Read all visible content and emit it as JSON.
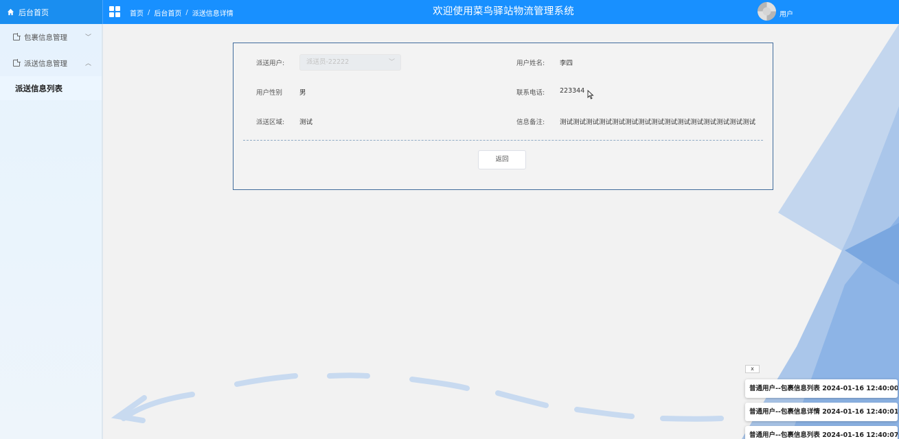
{
  "header": {
    "home_label": "后台首页",
    "breadcrumb": [
      "首页",
      "后台首页",
      "派送信息详情"
    ],
    "breadcrumb_sep": "/",
    "title": "欢迎使用菜鸟驿站物流管理系统",
    "user_label": "用户",
    "bg_color": "#1890ff"
  },
  "sidebar": {
    "groups": [
      {
        "label": "包裹信息管理",
        "chevron": "﹀",
        "expanded": false
      },
      {
        "label": "派送信息管理",
        "chevron": "︿",
        "expanded": true
      }
    ],
    "active_item": "派送信息列表"
  },
  "form": {
    "rows": [
      {
        "left_label": "派送用户:",
        "left_value": "派送员-22222",
        "right_label": "用户姓名:",
        "right_value": "李四"
      },
      {
        "left_label": "用户性别",
        "left_value": "男",
        "right_label": "联系电话:",
        "right_value": "223344"
      },
      {
        "left_label": "派送区域:",
        "left_value": "测试",
        "right_label": "信息备注:",
        "right_value": "测试测试测试测试测试测试测试测试测试测试测试测试测试测试测试"
      }
    ],
    "back_label": "返回",
    "border_color": "#3f6a9b"
  },
  "notifications": {
    "close_label": "x",
    "items": [
      "普通用户--包裹信息列表 2024-01-16 12:40:00",
      "普通用户--包裹信息详情 2024-01-16 12:40:01",
      "普通用户--包裹信息列表 2024-01-16 12:40:07"
    ]
  }
}
